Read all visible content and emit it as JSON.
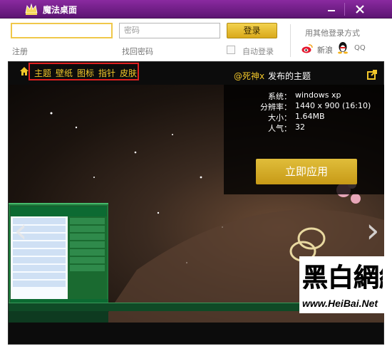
{
  "window": {
    "title": "魔法桌面"
  },
  "login": {
    "password_placeholder": "密码",
    "login_button": "登录",
    "other_methods": "用其他登录方式",
    "register": "注册",
    "find_password": "找回密码",
    "auto_login": "自动登录",
    "weibo": "新浪",
    "qq": "QQ"
  },
  "nav": {
    "tabs": [
      "主题",
      "壁纸",
      "图标",
      "指针",
      "皮肤"
    ]
  },
  "theme": {
    "author": "@死神x",
    "publish_text": "发布的主题",
    "fields": [
      {
        "key": "系统：",
        "value": "windows xp"
      },
      {
        "key": "分辨率：",
        "value": "1440 x 900 (16:10)"
      },
      {
        "key": "大小：",
        "value": "1.64MB"
      },
      {
        "key": "人气：",
        "value": "32"
      }
    ],
    "apply_button": "立即应用"
  },
  "watermark": {
    "text": "黑白網絡",
    "url": "www.HeiBai.Net"
  },
  "colors": {
    "accent": "#f2c72a",
    "titlebar": "#7a2290",
    "apply": "#d4ad2a",
    "highlight_box": "#e02020"
  }
}
